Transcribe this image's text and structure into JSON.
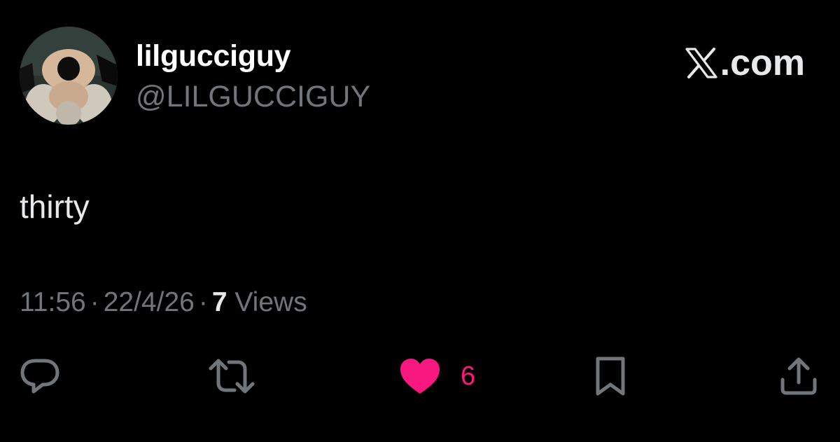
{
  "author": {
    "display_name": "lilgucciguy",
    "handle": "@LILGUCCIGUY"
  },
  "brand": {
    "suffix": ".com",
    "logo_icon": "x-logo-icon"
  },
  "tweet": {
    "text": "thirty",
    "time": "11:56",
    "separator": "·",
    "date": "22/4/26",
    "views_count": "7",
    "views_label": "Views"
  },
  "actions": {
    "reply_icon": "reply-icon",
    "retweet_icon": "retweet-icon",
    "like_icon": "heart-icon",
    "like_count": "6",
    "like_active": true,
    "bookmark_icon": "bookmark-icon",
    "share_icon": "share-icon"
  },
  "colors": {
    "background": "#000000",
    "primary_text": "#e7e9ea",
    "secondary_text": "#71767b",
    "like": "#f91880"
  }
}
